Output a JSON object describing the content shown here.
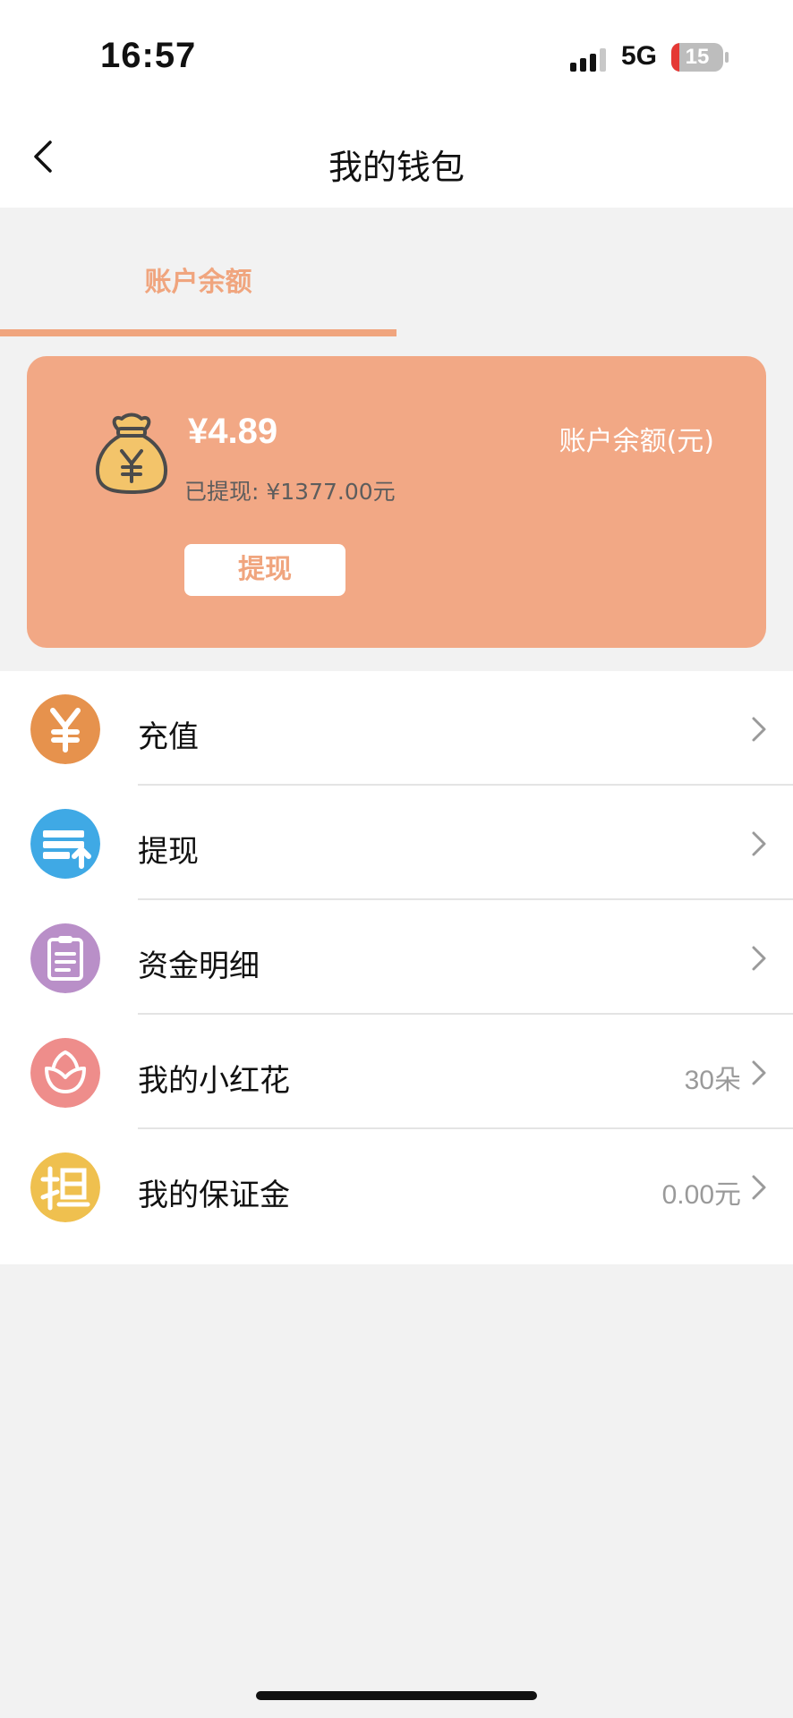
{
  "status_bar": {
    "time": "16:57",
    "network": "5G",
    "battery_level": "15",
    "battery_fraction": 0.15,
    "signal_icon": "signal-bars-icon"
  },
  "nav": {
    "title": "我的钱包",
    "back_icon": "chevron-left-icon"
  },
  "tabs": [
    {
      "label": "账户余额",
      "active": true
    }
  ],
  "balance_card": {
    "amount": "¥4.89",
    "label": "账户余额(元)",
    "withdrawn": "已提现: ¥1377.00元",
    "withdraw_button": "提现",
    "icon": "money-bag-icon"
  },
  "menu": [
    {
      "label": "充值",
      "value": "",
      "icon": "yuan-icon",
      "color": "#e6924d"
    },
    {
      "label": "提现",
      "value": "",
      "icon": "withdraw-card-icon",
      "color": "#3fa9e5"
    },
    {
      "label": "资金明细",
      "value": "",
      "icon": "clipboard-icon",
      "color": "#b98fc8"
    },
    {
      "label": "我的小红花",
      "value": "30朵",
      "icon": "flower-icon",
      "color": "#ee8d8b"
    },
    {
      "label": "我的保证金",
      "value": "0.00元",
      "icon": "guarantee-icon",
      "color": "#efc04f"
    }
  ],
  "colors": {
    "accent": "#f0a57e",
    "card": "#f2a885",
    "background": "#f2f2f2"
  }
}
